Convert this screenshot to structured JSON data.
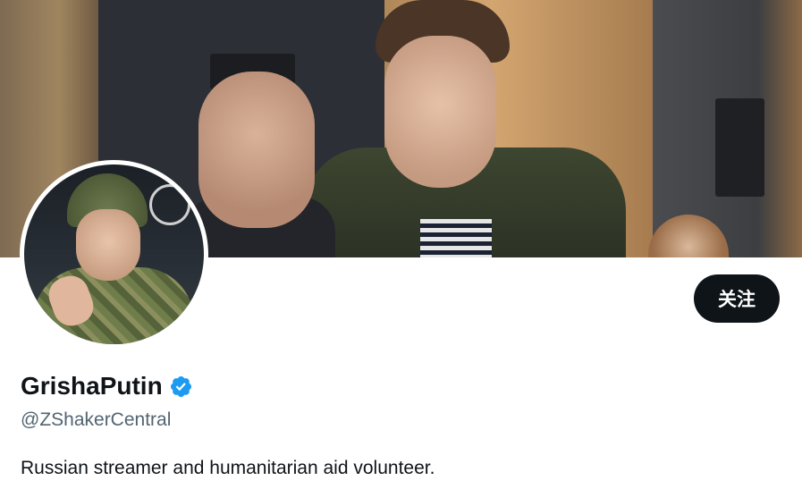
{
  "profile": {
    "display_name": "GrishaPutin",
    "handle": "@ZShakerCentral",
    "bio": "Russian streamer and humanitarian aid volunteer.",
    "verified": true
  },
  "actions": {
    "follow_label": "关注"
  },
  "icons": {
    "verified": "verified-badge-icon"
  },
  "colors": {
    "verified_badge": "#1d9bf0",
    "follow_button_bg": "#0f1419",
    "handle_text": "#536471"
  }
}
